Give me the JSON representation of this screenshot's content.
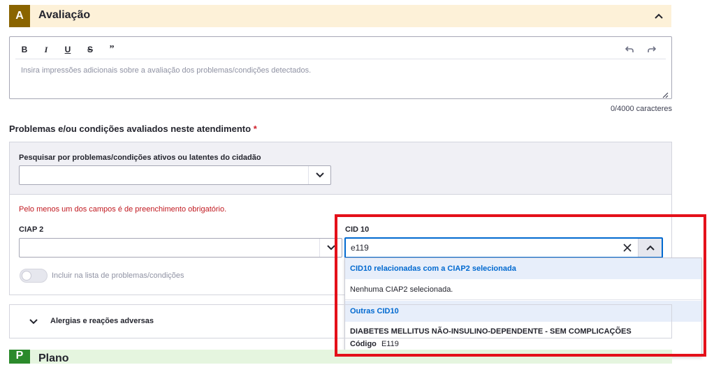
{
  "section_a": {
    "badge": "A",
    "title": "Avaliação"
  },
  "editor": {
    "placeholder": "Insira impressões adicionais sobre a avaliação dos problemas/condições detectados.",
    "char_count": "0/4000 caracteres"
  },
  "problems": {
    "title": "Problemas e/ou condições avaliados neste atendimento",
    "required_mark": "*",
    "search_label": "Pesquisar por problemas/condições ativos ou latentes do cidadão",
    "error": "Pelo menos um dos campos é de preenchimento obrigatório.",
    "ciap_label": "CIAP 2",
    "cid_label": "CID 10",
    "cid_value": "e119",
    "toggle_label": "Incluir na lista de problemas/condições"
  },
  "cid_dropdown": {
    "group1": "CID10 relacionadas com a CIAP2 selecionada",
    "group1_empty": "Nenhuma CIAP2 selecionada.",
    "group2": "Outras CID10",
    "option_title": "DIABETES MELLITUS NÃO-INSULINO-DEPENDENTE - SEM COMPLICAÇÕES",
    "option_code_label": "Código",
    "option_code": "E119"
  },
  "allergies": {
    "label": "Alergias e reações adversas"
  },
  "section_p": {
    "badge": "P",
    "title": "Plano"
  },
  "colors": {
    "section_a_badge": "#8a6400",
    "section_a_bg": "#fdf1d8",
    "section_p_badge": "#2b8a2b",
    "section_p_bg": "#e5f5df",
    "primary": "#0069d0",
    "error": "#c11920",
    "highlight": "#e4101a"
  }
}
